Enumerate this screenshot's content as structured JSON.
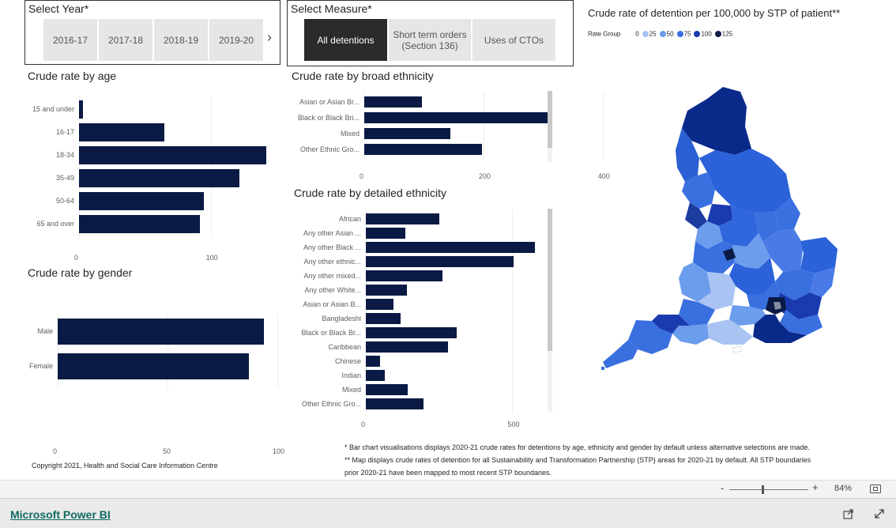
{
  "year_slicer": {
    "title": "Select Year*",
    "options": [
      "2016-17",
      "2017-18",
      "2018-19",
      "2019-20"
    ],
    "next_arrow": "›"
  },
  "measure_slicer": {
    "title": "Select Measure*",
    "options": [
      "All detentions",
      "Short term orders (Section 136)",
      "Uses of CTOs"
    ],
    "selected_index": 0
  },
  "map": {
    "title": "Crude rate of detention per 100,000 by STP of patient**",
    "legend_label": "Rate Group",
    "legend": [
      {
        "label": "0",
        "color": "#ffffff"
      },
      {
        "label": "25",
        "color": "#a9c4f2"
      },
      {
        "label": "50",
        "color": "#6c9cec"
      },
      {
        "label": "75",
        "color": "#3a6fe0"
      },
      {
        "label": "100",
        "color": "#1a3bb0"
      },
      {
        "label": "125",
        "color": "#0a1a44"
      }
    ]
  },
  "charts": {
    "age": {
      "title": "Crude rate by age",
      "categories": [
        "15 and under",
        "16-17",
        "18-34",
        "35-49",
        "50-64",
        "65 and over"
      ],
      "ticks": [
        "0",
        "100"
      ]
    },
    "broad_ethnicity": {
      "title": "Crude rate by broad ethnicity",
      "categories": [
        "Asian or Asian Br...",
        "Black or Black Bri...",
        "Mixed",
        "Other Ethnic Gro..."
      ],
      "ticks": [
        "0",
        "200",
        "400"
      ]
    },
    "detailed_ethnicity": {
      "title": "Crude rate by detailed ethnicity",
      "categories": [
        "African",
        "Any other Asian ...",
        "Any other Black ...",
        "Any other ethnic...",
        "Any other mixed...",
        "Any other White...",
        "Asian or Asian B...",
        "Bangladeshi",
        "Black or Black Br...",
        "Caribbean",
        "Chinese",
        "Indian",
        "Mixed",
        "Other Ethnic Gro..."
      ],
      "ticks": [
        "0",
        "500"
      ]
    },
    "gender": {
      "title": "Crude rate by gender",
      "categories": [
        "Male",
        "Female"
      ],
      "ticks": [
        "0",
        "50",
        "100"
      ]
    }
  },
  "chart_data": [
    {
      "type": "bar",
      "title": "Crude rate by age",
      "categories": [
        "15 and under",
        "16-17",
        "18-34",
        "35-49",
        "50-64",
        "65 and over"
      ],
      "values": [
        3,
        65,
        142,
        122,
        95,
        92
      ],
      "xlim": [
        0,
        150
      ]
    },
    {
      "type": "bar",
      "title": "Crude rate by broad ethnicity",
      "categories": [
        "Asian or Asian Br...",
        "Black or Black Bri...",
        "Mixed",
        "Other Ethnic Gro..."
      ],
      "values": [
        97,
        311,
        145,
        198
      ],
      "xlim": [
        0,
        420
      ]
    },
    {
      "type": "bar",
      "title": "Crude rate by detailed ethnicity",
      "categories": [
        "African",
        "Any other Asian ...",
        "Any other Black ...",
        "Any other ethnic...",
        "Any other mixed...",
        "Any other White...",
        "Asian or Asian B...",
        "Bangladeshi",
        "Black or Black Br...",
        "Caribbean",
        "Chinese",
        "Indian",
        "Mixed",
        "Other Ethnic Gro..."
      ],
      "values": [
        250,
        135,
        578,
        505,
        262,
        140,
        95,
        118,
        310,
        280,
        48,
        65,
        143,
        197
      ],
      "xlim": [
        0,
        620
      ]
    },
    {
      "type": "bar",
      "title": "Crude rate by gender",
      "categories": [
        "Male",
        "Female"
      ],
      "values": [
        94,
        87
      ],
      "xlim": [
        0,
        100
      ]
    }
  ],
  "notes": {
    "line1": "* Bar chart visualisations displays 2020-21 crude rates for detentions by age, ethnicity and gender by default unless alternative selections are made.",
    "line2": "** Map displays crude rates of detention for all Sustainability and Transformation Partnership (STP) areas for 2020-21 by default. All STP boundaries",
    "line3": "prior 2020-21 have been mapped to most recent STP boundaries."
  },
  "copyright": "Copyright 2021, Health and Social Care Information Centre",
  "zoom": {
    "minus": "-",
    "plus": "+",
    "level": "84%",
    "fraction": 0.42
  },
  "footer": {
    "brand": "Microsoft Power BI"
  }
}
